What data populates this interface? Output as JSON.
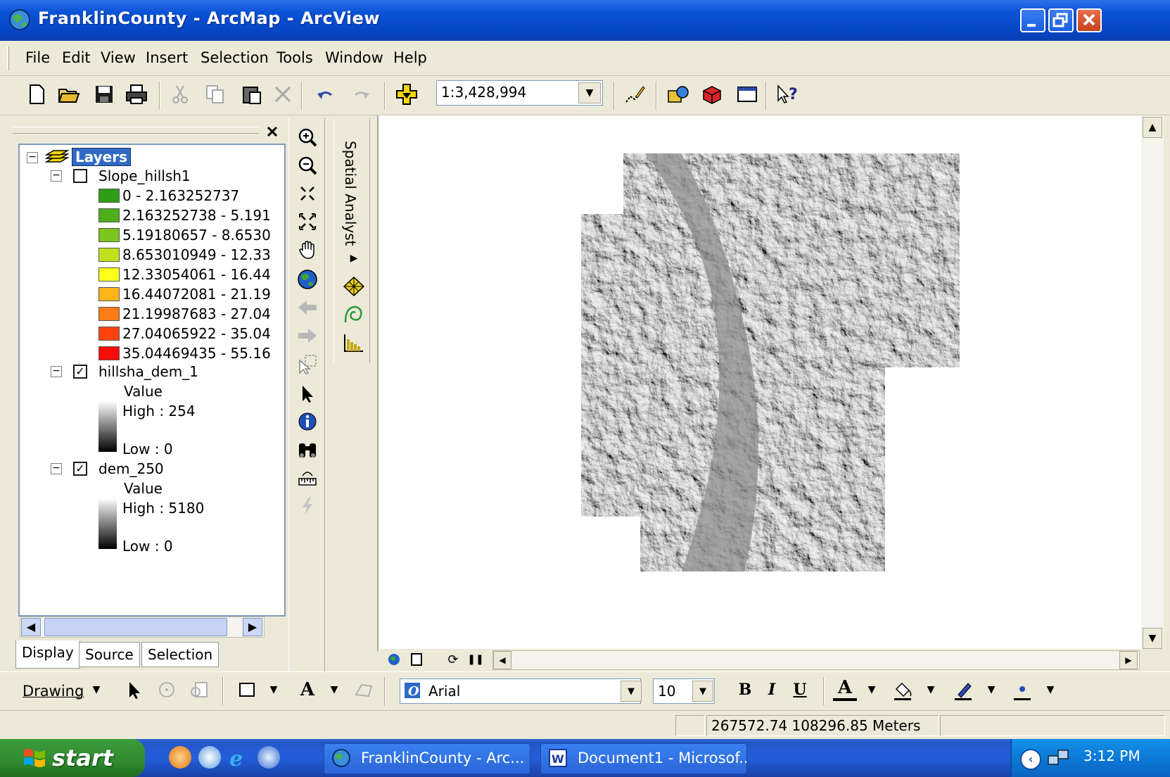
{
  "window": {
    "title": "FranklinCounty - ArcMap - ArcView"
  },
  "menu": [
    "File",
    "Edit",
    "View",
    "Insert",
    "Selection",
    "Tools",
    "Window",
    "Help"
  ],
  "toolbar": {
    "scale_value": "1:3,428,994",
    "help_label": "?"
  },
  "toc": {
    "root_label": "Layers",
    "layers": [
      {
        "name": "Slope_hillsh1",
        "checked": false,
        "classes": [
          {
            "label": "0 - 2.163252737",
            "color": "#2f9e16"
          },
          {
            "label": "2.163252738 - 5.191",
            "color": "#4db01a"
          },
          {
            "label": "5.19180657 - 8.6530",
            "color": "#7cc41e"
          },
          {
            "label": "8.653010949 - 12.33",
            "color": "#c0e21e"
          },
          {
            "label": "12.33054061 - 16.44",
            "color": "#ffff1a"
          },
          {
            "label": "16.44072081 - 21.19",
            "color": "#ffb41a"
          },
          {
            "label": "21.19987683 - 27.04",
            "color": "#ff7b14"
          },
          {
            "label": "27.04065922 - 35.04",
            "color": "#ff4310"
          },
          {
            "label": "35.04469435 - 55.16",
            "color": "#ff0a0a"
          }
        ]
      },
      {
        "name": "hillsha_dem_1",
        "checked": true,
        "value_label": "Value",
        "high": "High : 254",
        "low": "Low : 0"
      },
      {
        "name": "dem_250",
        "checked": true,
        "value_label": "Value",
        "high": "High : 5180",
        "low": "Low : 0"
      }
    ],
    "tabs": [
      "Display",
      "Source",
      "Selection"
    ]
  },
  "spatial_analyst": {
    "label": "Spatial Analyst"
  },
  "drawing": {
    "menu_label": "Drawing",
    "font_name": "Arial",
    "font_size": "10",
    "bold": "B",
    "italic": "I",
    "underline": "U",
    "text_color_glyph": "A"
  },
  "status": {
    "coordinates": "267572.74  108296.85 Meters"
  },
  "taskbar": {
    "start_label": "start",
    "tasks": [
      "FranklinCounty - Arc...",
      "Document1 - Microsof..."
    ],
    "clock": "3:12 PM"
  },
  "colors": {
    "titlebar": "#0a52d6",
    "chrome": "#ece9d8",
    "taskbar": "#245edb",
    "start_button": "#2f8a2f",
    "selection": "#316ac5"
  }
}
